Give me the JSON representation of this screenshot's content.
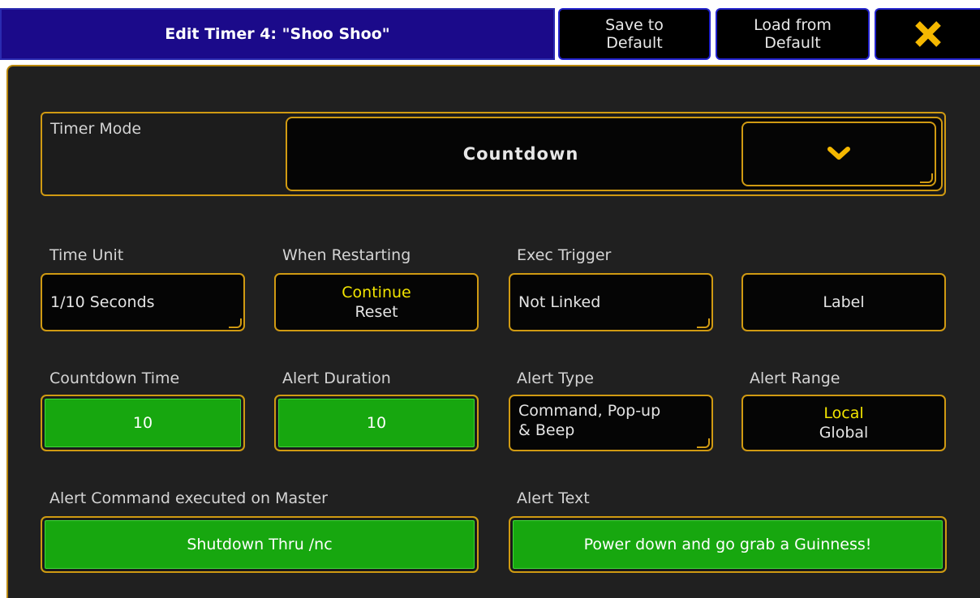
{
  "header": {
    "title": "Edit Timer 4: \"Shoo Shoo\"",
    "save_label_line1": "Save to",
    "save_label_line2": "Default",
    "load_label_line1": "Load from",
    "load_label_line2": "Default",
    "close_icon": "close-icon"
  },
  "timer_mode": {
    "label": "Timer Mode",
    "value": "Countdown",
    "dropdown_icon": "chevron-down-icon"
  },
  "time_unit": {
    "label": "Time Unit",
    "value": "1/10 Seconds"
  },
  "when_restarting": {
    "label": "When Restarting",
    "options": [
      "Continue",
      "Reset"
    ],
    "selected": "Continue"
  },
  "exec_trigger": {
    "label": "Exec Trigger",
    "value": "Not Linked",
    "label_button": "Label"
  },
  "countdown_time": {
    "label": "Countdown Time",
    "value": "10"
  },
  "alert_duration": {
    "label": "Alert Duration",
    "value": "10"
  },
  "alert_type": {
    "label": "Alert Type",
    "value_line1": "Command, Pop-up",
    "value_line2": "& Beep"
  },
  "alert_range": {
    "label": "Alert Range",
    "options": [
      "Local",
      "Global"
    ],
    "selected": "Local"
  },
  "alert_command": {
    "label": "Alert Command executed on Master",
    "value": "Shutdown Thru /nc"
  },
  "alert_text": {
    "label": "Alert Text",
    "value": "Power down and go grab a Guinness!"
  },
  "colors": {
    "header_bg": "#1b0a8a",
    "accent_border": "#d09a12",
    "active_green": "#17a70f",
    "selected_option": "#f2e400",
    "panel_bg": "#202020"
  }
}
